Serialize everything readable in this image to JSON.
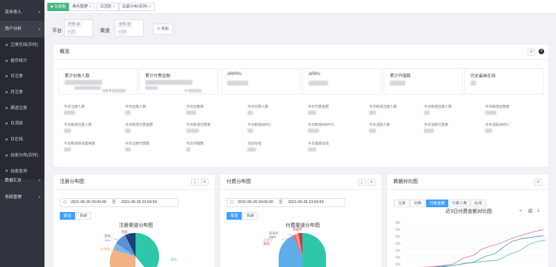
{
  "sidebar": {
    "items": [
      {
        "label": "流水收入"
      },
      {
        "label": "用户分析"
      },
      {
        "label": "数据汇总"
      },
      {
        "label": "系统管理"
      }
    ],
    "subitems": [
      {
        "label": "注册在线(实时)"
      },
      {
        "label": "留存统计"
      },
      {
        "label": "日注册"
      },
      {
        "label": "月注册"
      },
      {
        "label": "渠道注册"
      },
      {
        "label": "日活跃"
      },
      {
        "label": "日在线"
      },
      {
        "label": "玩家分布(实时)"
      },
      {
        "label": "玩家查询"
      }
    ]
  },
  "tags": [
    {
      "label": "仪表盘"
    },
    {
      "label": "角色管理"
    },
    {
      "label": "日活跃"
    },
    {
      "label": "玩家分布(实时)"
    }
  ],
  "filter": {
    "platform_label": "平台",
    "channel_label": "渠道",
    "platform_chip": "全部",
    "platform_more": "+ 22",
    "channel_chip": "全部",
    "channel_more": "+ 23",
    "refresh_label": "刷新"
  },
  "overview": {
    "title": "概览",
    "stats": [
      {
        "label": "累计创角人数",
        "note": "创角率"
      },
      {
        "label": "累计付费金额",
        "note": "付%"
      },
      {
        "label": "ARPPU",
        "note": ""
      },
      {
        "label": "ARPU",
        "note": ""
      },
      {
        "label": "累计开服数",
        "note": ""
      },
      {
        "label": "历史最高在线",
        "note": ""
      }
    ],
    "metrics_row1": [
      "今日注册人数",
      "今日创角人数",
      "今日创角率",
      "今日付费人数",
      "今日付费金额",
      "今日新增注册人数",
      "今日新增创角人数",
      "今日新增创角率"
    ],
    "metrics_row2": [
      "今日新增付费人数",
      "今日新增付费金额",
      "今日新增付费率",
      "今日新增ARPU",
      "今日新增ARPPU",
      "今日活跃人数",
      "今日活跃付费率",
      "今日活跃ARPU"
    ],
    "metrics_row3": [
      "今日新增存活角色数",
      "今日注册付费数",
      "今日开服数",
      "当前在线",
      "今日最高在线"
    ]
  },
  "register_card": {
    "title": "注册分布图",
    "date_start": "2021-05-26 00:00:00",
    "date_sep": "至",
    "date_end": "2021-05-26 23:59:59",
    "seg_on": "渠道",
    "seg_off": "系统",
    "chart_title": "注册渠道分布图",
    "pie_labels": [
      "魅族",
      "其他",
      "vivo",
      "应用宝",
      "华为"
    ]
  },
  "pay_card": {
    "title": "付费分布图",
    "date_start": "2021-05-26 00:00:00",
    "date_sep": "至",
    "date_end": "2021-05-26 23:59:59",
    "seg_on": "渠道",
    "seg_off": "系统",
    "chart_title": "付费渠道分布图",
    "pie_labels": [
      "渠道商",
      "oppo",
      "应用宝",
      "魅族"
    ]
  },
  "compare_card": {
    "title": "数据对比图",
    "tabs": [
      {
        "label": "注册",
        "on": false
      },
      {
        "label": "创角",
        "on": false
      },
      {
        "label": "付费金额",
        "on": true
      },
      {
        "label": "付费人数",
        "on": false
      },
      {
        "label": "在线",
        "on": false
      }
    ],
    "chart_title": "近3日付费金额对比图"
  },
  "colors": {
    "sidebar_bg": "#30343e",
    "tag_active": "#42b983",
    "primary": "#409eff",
    "line_red": "#e86a86",
    "line_blue": "#4a90d9",
    "line_teal": "#59c4bc"
  },
  "chart_data": [
    {
      "type": "pie",
      "title": "注册渠道分布图",
      "categories": [
        "魅族",
        "其他",
        "vivo",
        "应用宝",
        "华为"
      ]
    },
    {
      "type": "pie",
      "title": "付费渠道分布图",
      "categories": [
        "渠道商",
        "oppo",
        "应用宝",
        "魅族"
      ]
    },
    {
      "type": "line",
      "title": "近3日付费金额对比图"
    }
  ]
}
